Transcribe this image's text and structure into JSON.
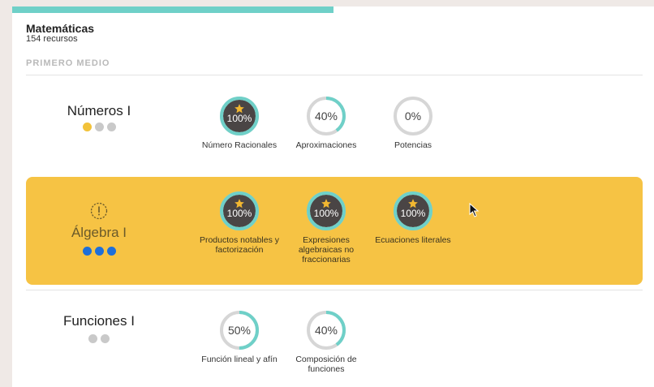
{
  "header": {
    "title": "Matemáticas",
    "resource_count": "154 recursos",
    "progress_fraction": 0.5
  },
  "section": {
    "heading": "PRIMERO MEDIO"
  },
  "colors": {
    "accent": "#6fd0c8",
    "highlight": "#f6c344",
    "dot_yellow": "#f2c23a",
    "dot_gray": "#c9c9c9",
    "dot_blue": "#1e6fd9",
    "done_fill": "#4a4545",
    "star": "#f2b731"
  },
  "units": [
    {
      "title": "Números I",
      "highlighted": false,
      "dots": [
        "yellow",
        "gray",
        "gray"
      ],
      "skills": [
        {
          "percent": "100%",
          "value": 1.0,
          "completed": true,
          "label": "Número Racionales"
        },
        {
          "percent": "40%",
          "value": 0.4,
          "completed": false,
          "label": "Aproximaciones"
        },
        {
          "percent": "0%",
          "value": 0.0,
          "completed": false,
          "label": "Potencias"
        }
      ]
    },
    {
      "title": "Álgebra I",
      "highlighted": true,
      "alert_icon": "exclamation-circle-icon",
      "dots": [
        "blue",
        "blue",
        "blue"
      ],
      "skills": [
        {
          "percent": "100%",
          "value": 1.0,
          "completed": true,
          "label": "Productos notables y factorización"
        },
        {
          "percent": "100%",
          "value": 1.0,
          "completed": true,
          "label": "Expresiones algebraicas no fraccionarias"
        },
        {
          "percent": "100%",
          "value": 1.0,
          "completed": true,
          "label": "Ecuaciones literales"
        }
      ]
    },
    {
      "title": "Funciones I",
      "highlighted": false,
      "dots": [
        "gray",
        "gray"
      ],
      "skills": [
        {
          "percent": "50%",
          "value": 0.5,
          "completed": false,
          "label": "Función lineal y afín"
        },
        {
          "percent": "40%",
          "value": 0.4,
          "completed": false,
          "label": "Composición de funciones"
        }
      ]
    }
  ]
}
